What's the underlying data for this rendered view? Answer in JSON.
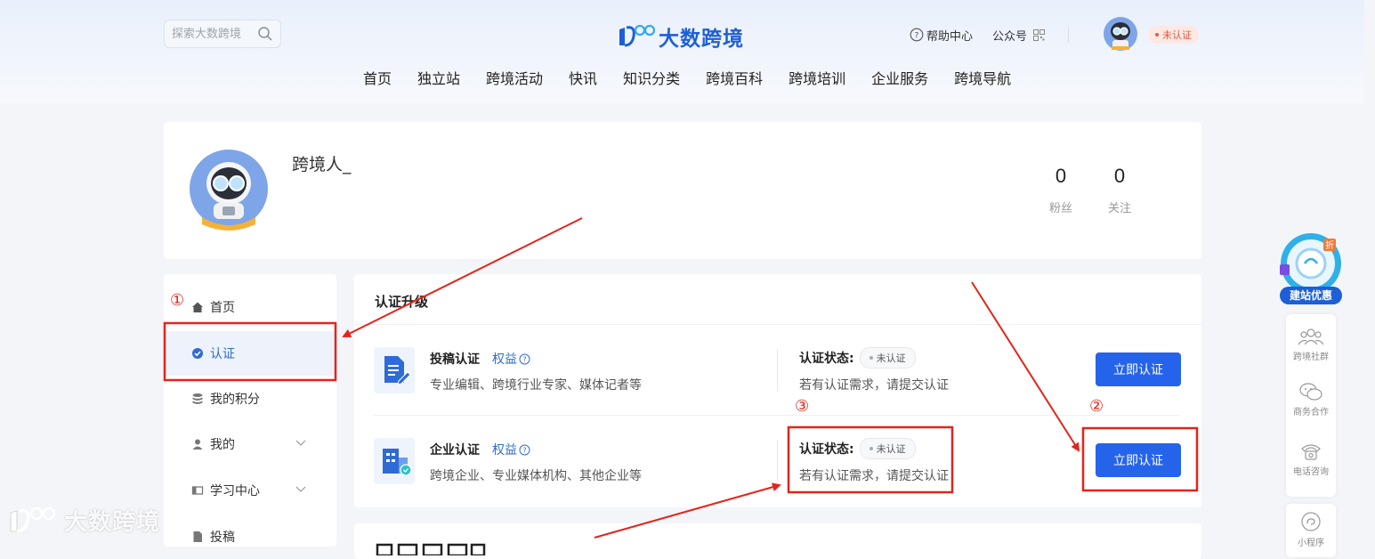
{
  "header": {
    "search_placeholder": "探索大数跨境",
    "logo_text": "大数跨境",
    "help_label": "帮助中心",
    "wechat_label": "公众号",
    "auth_badge": "未认证",
    "nav": [
      "首页",
      "独立站",
      "跨境活动",
      "快讯",
      "知识分类",
      "跨境百科",
      "跨境培训",
      "企业服务",
      "跨境导航"
    ]
  },
  "profile": {
    "username": "跨境人_",
    "fans_count": "0",
    "fans_label": "粉丝",
    "follow_count": "0",
    "follow_label": "关注"
  },
  "sidebar": {
    "items": [
      {
        "label": "首页"
      },
      {
        "label": "认证"
      },
      {
        "label": "我的积分"
      },
      {
        "label": "我的"
      },
      {
        "label": "学习中心"
      },
      {
        "label": "投稿"
      }
    ]
  },
  "main": {
    "title": "认证升级",
    "rows": [
      {
        "title": "投稿认证",
        "rights": "权益",
        "desc": "专业编辑、跨境行业专家、媒体记者等",
        "status_label": "认证状态:",
        "status_value": "未认证",
        "hint": "若有认证需求，请提交认证",
        "button": "立即认证"
      },
      {
        "title": "企业认证",
        "rights": "权益",
        "desc": "跨境企业、专业媒体机构、其他企业等",
        "status_label": "认证状态:",
        "status_value": "未认证",
        "hint": "若有认证需求，请提交认证",
        "button": "立即认证"
      }
    ]
  },
  "float": {
    "promo": "建站优惠",
    "promo_tag": "折",
    "items": [
      "跨境社群",
      "商务合作",
      "电话咨询",
      "小程序"
    ]
  },
  "watermark": "大数跨境",
  "annotations": [
    "①",
    "②",
    "③"
  ],
  "colors": {
    "brand": "#2563eb",
    "link": "#2f6bd4",
    "annotation": "#e3241b",
    "badge_bg": "#fde8e4",
    "badge_text": "#e25a43"
  }
}
